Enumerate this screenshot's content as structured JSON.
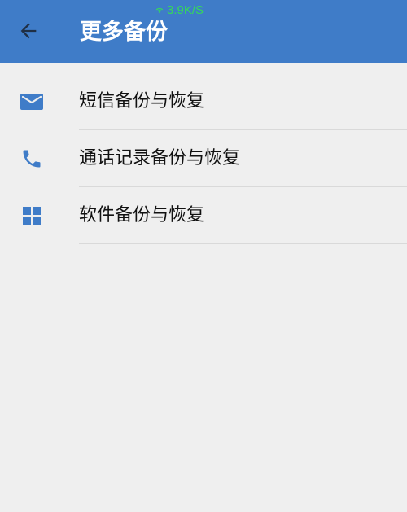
{
  "status_bar": {
    "network_speed": "3.9K/S",
    "speed_color": "#35d85b"
  },
  "header": {
    "title": "更多备份",
    "background_color": "#3f7cc8",
    "back_icon": "arrow-left-icon"
  },
  "menu": {
    "items": [
      {
        "label": "短信备份与恢复",
        "icon": "mail-icon"
      },
      {
        "label": "通话记录备份与恢复",
        "icon": "phone-icon"
      },
      {
        "label": "软件备份与恢复",
        "icon": "apps-grid-icon"
      }
    ],
    "icon_color": "#3f7cc8"
  }
}
